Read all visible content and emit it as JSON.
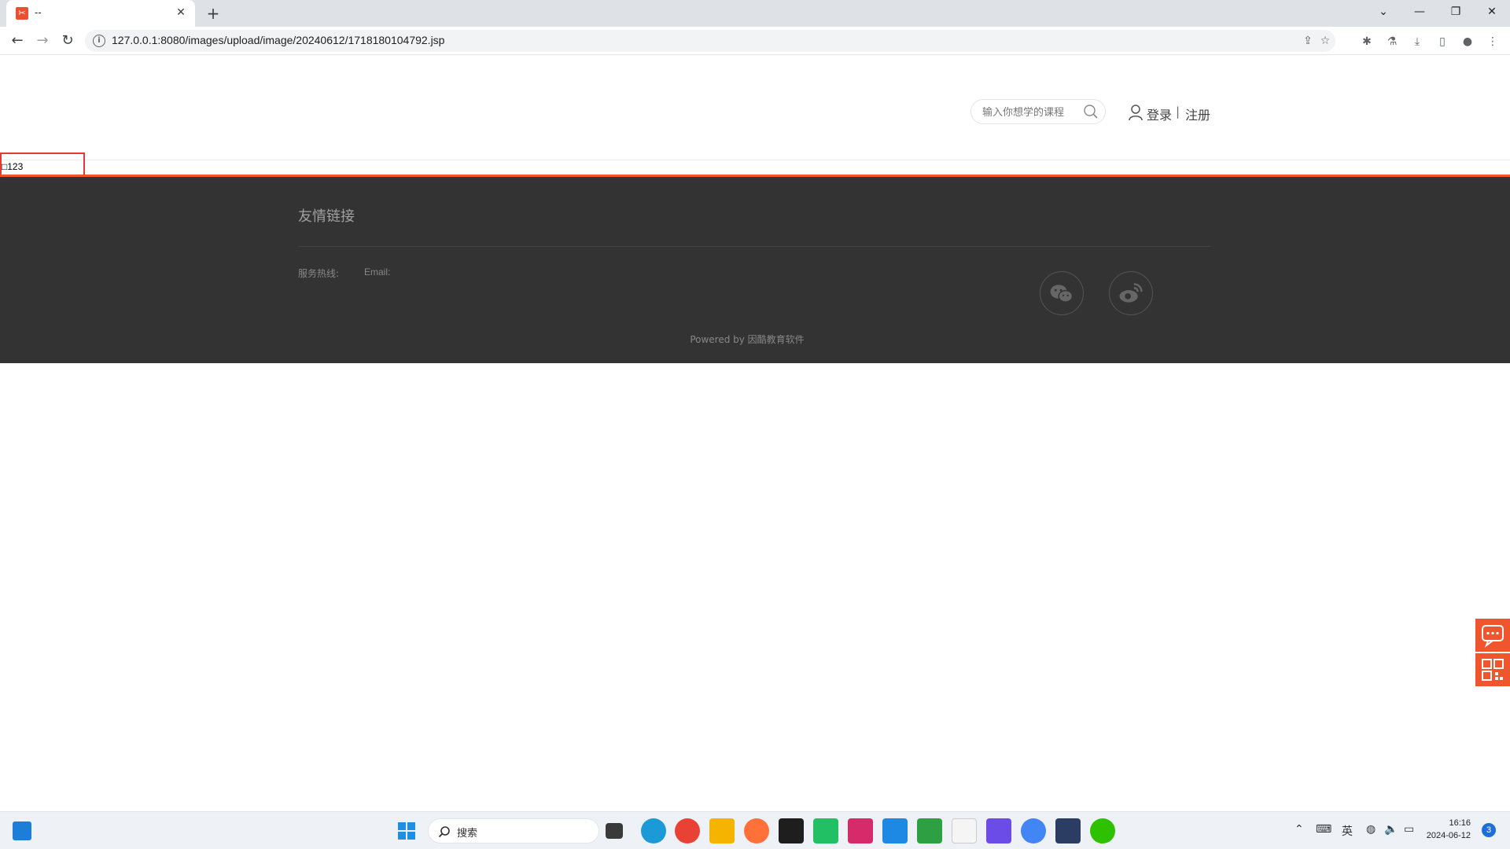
{
  "browser": {
    "tab_title": "--",
    "favicon_glyph": "✂",
    "url": "127.0.0.1:8080/images/upload/image/20240612/1718180104792.jsp",
    "window_controls": [
      "⌄",
      "—",
      "❐",
      "✕"
    ]
  },
  "header": {
    "search_placeholder": "输入你想学的课程",
    "login_label": "登录",
    "separator": "|",
    "register_label": "注册"
  },
  "content": {
    "broken_text": "□123"
  },
  "footer": {
    "friend_links_title": "友情链接",
    "hotline_label": "服务热线:",
    "email_label": "Email:",
    "powered_by": "Powered by 因酷教育软件"
  },
  "taskbar": {
    "search_label": "搜索",
    "ime_label": "英",
    "time": "16:16",
    "date": "2024-06-12",
    "notification_count": "3"
  },
  "colors": {
    "accent": "#f0552d",
    "footer_bg": "#333333",
    "highlight_box": "#e53935"
  }
}
